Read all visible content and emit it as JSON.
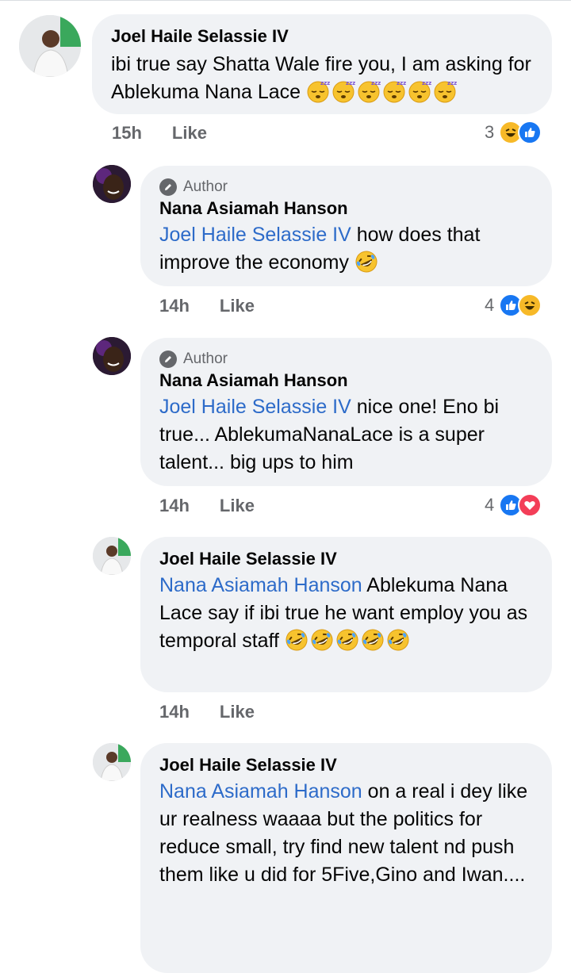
{
  "comments": [
    {
      "author": "Joel Haile Selassie IV",
      "text": "ibi true say Shatta Wale fire you, I am asking for Ablekuma Nana Lace",
      "emoji": "sleeping-face",
      "emoji_count": 6,
      "time": "15h",
      "like": "Like",
      "reaction_count": "3",
      "reactions": [
        "haha-icon",
        "like-icon"
      ]
    },
    {
      "author_badge": "Author",
      "author": "Nana Asiamah Hanson",
      "mention": "Joel Haile Selassie IV",
      "text": " how does that improve the economy",
      "emoji": "rolling-on-floor-laughing",
      "time": "14h",
      "like": "Like",
      "reaction_count": "4",
      "reactions": [
        "like-icon",
        "haha-icon"
      ]
    },
    {
      "author_badge": "Author",
      "author": "Nana Asiamah Hanson",
      "mention": "Joel Haile Selassie IV",
      "text": " nice one! Eno bi true... AblekumaNanaLace is a super talent... big ups to him",
      "time": "14h",
      "like": "Like",
      "reaction_count": "4",
      "reactions": [
        "like-icon",
        "love-icon"
      ]
    },
    {
      "author": "Joel Haile Selassie IV",
      "mention": "Nana Asiamah Hanson",
      "text": " Ablekuma Nana Lace say if ibi true he want employ you as temporal staff",
      "emoji": "rolling-on-floor-laughing",
      "emoji_count": 5,
      "time": "14h",
      "like": "Like"
    },
    {
      "author": "Joel Haile Selassie IV",
      "mention": "Nana Asiamah Hanson",
      "text": " on a real i dey like ur realness waaaa but the politics for reduce small, try find new talent nd push them like u did for 5Five,Gino and Iwan...."
    }
  ]
}
